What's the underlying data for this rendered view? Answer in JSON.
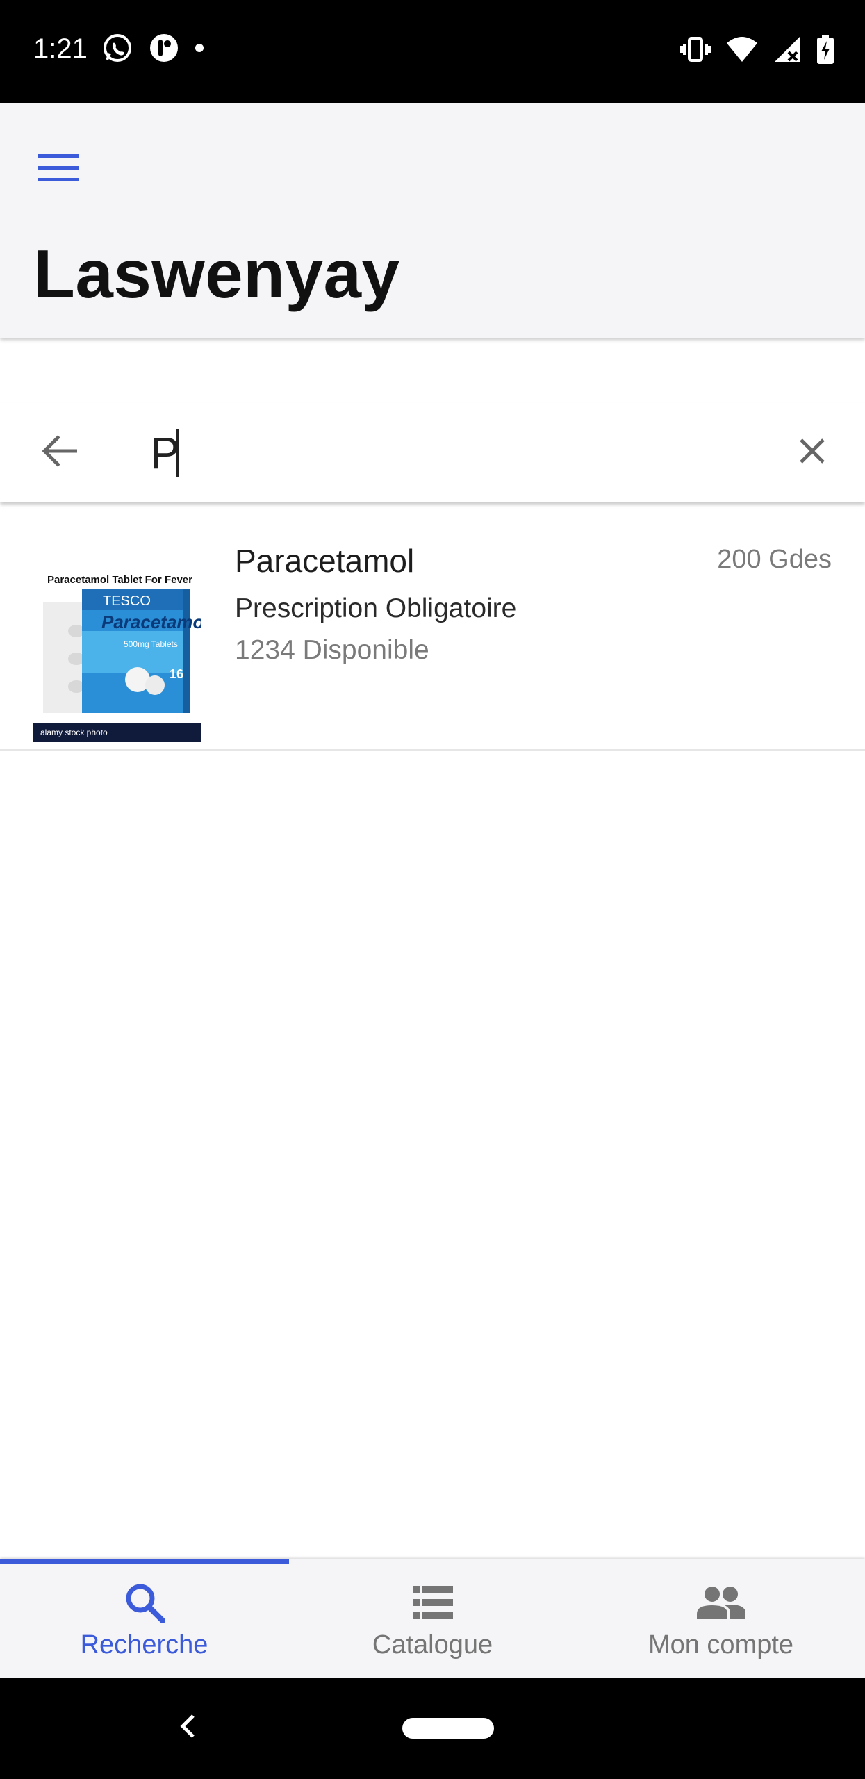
{
  "status_bar": {
    "time": "1:21",
    "left_icons": [
      "whatsapp-icon",
      "app-notification-icon",
      "dot-icon"
    ],
    "right_icons": [
      "vibrate-icon",
      "wifi-icon",
      "signal-icon",
      "battery-charging-icon"
    ]
  },
  "app_bar": {
    "title": "Laswenyay",
    "menu_icon": "hamburger-menu-icon"
  },
  "search": {
    "value": "P",
    "back_icon": "arrow-back-icon",
    "clear_icon": "close-icon"
  },
  "results": [
    {
      "name": "Paracetamol",
      "price": "200 Gdes",
      "prescription": "Prescription Obligatoire",
      "stock": "1234 Disponible",
      "image": {
        "caption": "Paracetamol Tablet For Fever",
        "brand": "TESCO",
        "product": "Paracetamol",
        "dose": "500mg Tablets",
        "count": "16",
        "watermark": "alamy stock photo"
      }
    }
  ],
  "bottom_nav": {
    "items": [
      {
        "label": "Recherche",
        "icon": "search-icon",
        "active": true
      },
      {
        "label": "Catalogue",
        "icon": "list-icon",
        "active": false
      },
      {
        "label": "Mon compte",
        "icon": "people-icon",
        "active": false
      }
    ]
  },
  "colors": {
    "accent": "#3b5bdb",
    "app_bar_bg": "#f5f5f7",
    "muted_text": "#7a7a7a"
  }
}
